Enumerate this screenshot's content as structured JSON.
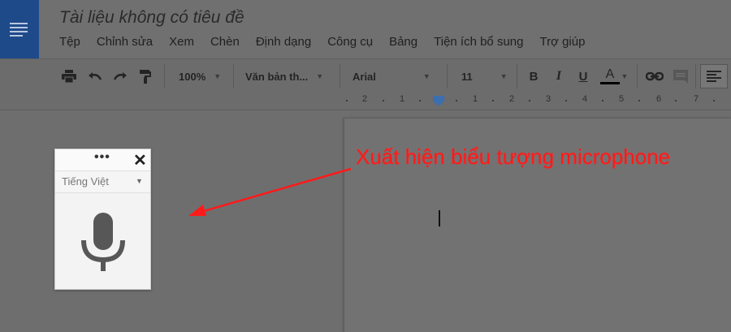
{
  "header": {
    "doc_title": "Tài liệu không có tiêu đề",
    "menu": [
      "Tệp",
      "Chỉnh sửa",
      "Xem",
      "Chèn",
      "Định dạng",
      "Công cụ",
      "Bảng",
      "Tiện ích bổ sung",
      "Trợ giúp"
    ]
  },
  "toolbar": {
    "zoom": "100%",
    "style": "Văn bản th...",
    "font": "Arial",
    "font_size": "11",
    "bold": "B",
    "italic": "I",
    "underline": "U",
    "text_color": "A"
  },
  "ruler": {
    "marks": [
      "2",
      "1",
      "1",
      "2",
      "3",
      "4",
      "5",
      "6",
      "7"
    ]
  },
  "voice_widget": {
    "language": "Tiếng Việt",
    "menu_dots": "•••",
    "close": "✕"
  },
  "annotation": {
    "text": "Xuất hiện biểu tượng microphone",
    "color": "#ff1a1a"
  },
  "colors": {
    "doc_icon": "#1e4a8a",
    "overlay": "#6e6e6e"
  }
}
